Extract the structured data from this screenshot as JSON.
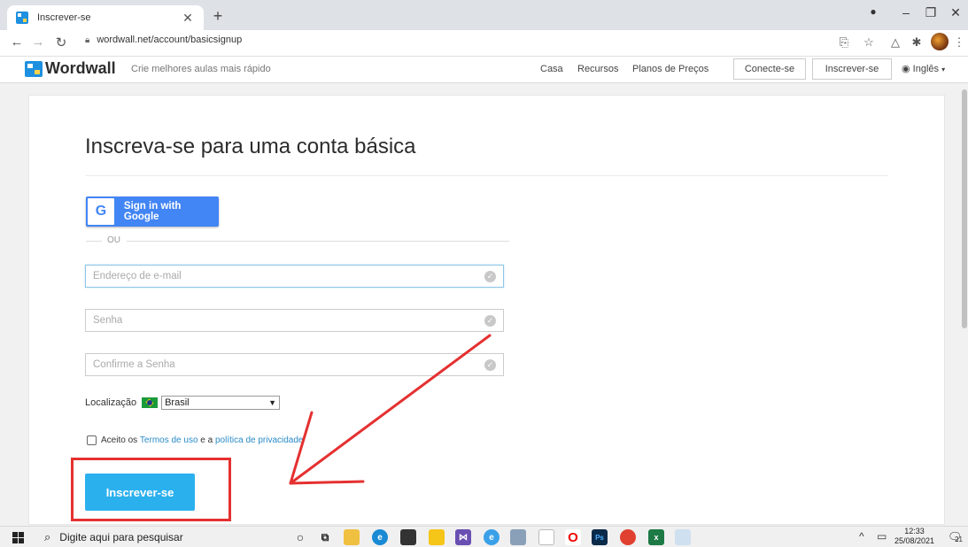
{
  "browser": {
    "tab_title": "Inscrever-se",
    "url": "wordwall.net/account/basicsignup"
  },
  "site": {
    "logo": "Wordwall",
    "tagline": "Crie melhores aulas mais rápido",
    "nav": {
      "casa": "Casa",
      "recursos": "Recursos",
      "planos": "Planos de Preços",
      "conecte": "Conecte-se",
      "inscrever": "Inscrever-se",
      "lang": "Inglês"
    }
  },
  "form": {
    "title": "Inscreva-se para uma conta básica",
    "google_label": "Sign in with Google",
    "or_label": "OU",
    "email_placeholder": "Endereço de e-mail",
    "password_placeholder": "Senha",
    "confirm_placeholder": "Confirme a Senha",
    "location_label": "Localização",
    "location_value": "Brasil",
    "terms_prefix": "Aceito os ",
    "terms_link": "Termos de uso",
    "terms_middle": " e a ",
    "privacy_link": "política de privacidade",
    "submit_label": "Inscrever-se"
  },
  "taskbar": {
    "search_placeholder": "Digite aqui para pesquisar",
    "time": "12:33",
    "date": "25/08/2021",
    "notifications": "21"
  },
  "colors": {
    "accent": "#2bb0ee",
    "google_blue": "#4285f4",
    "annotation_red": "#e53030",
    "link": "#2a8bc8"
  }
}
